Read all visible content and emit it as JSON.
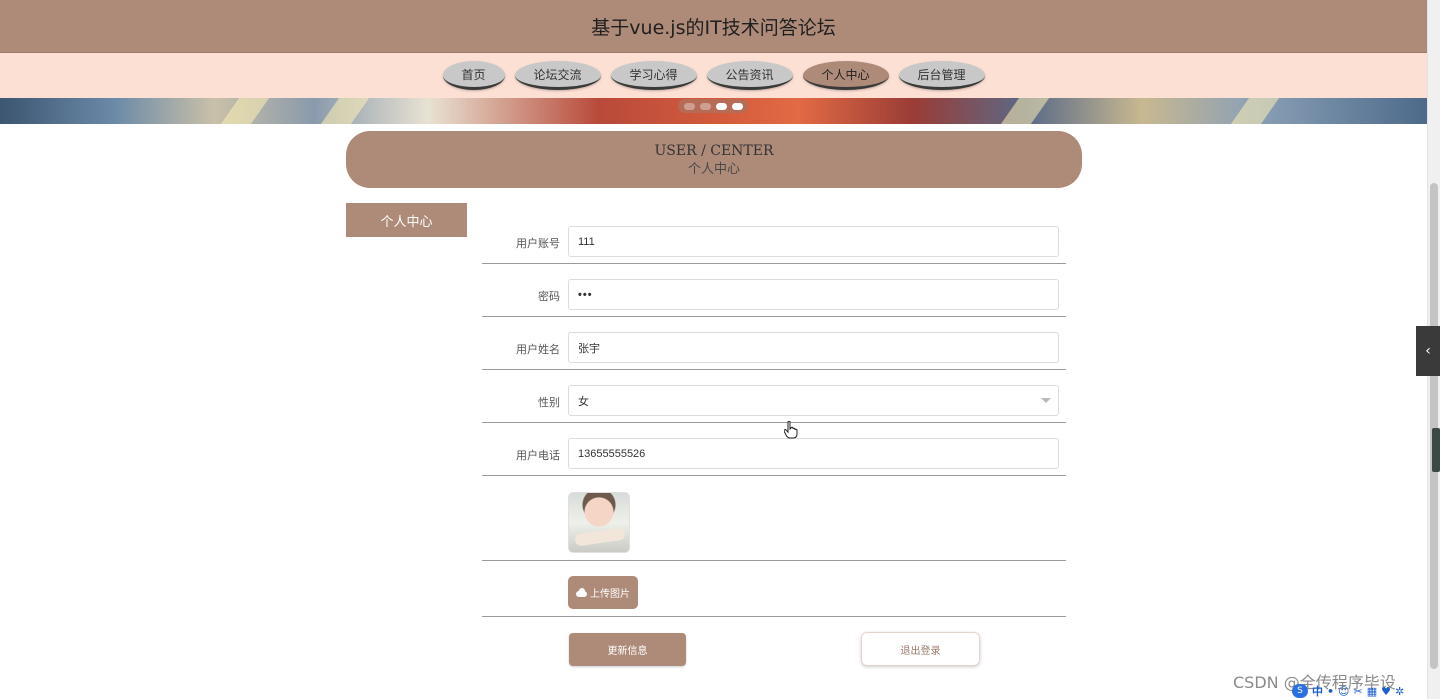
{
  "header": {
    "title": "基于vue.js的IT技术问答论坛"
  },
  "nav": {
    "items": [
      {
        "label": "首页"
      },
      {
        "label": "论坛交流"
      },
      {
        "label": "学习心得"
      },
      {
        "label": "公告资讯"
      },
      {
        "label": "个人中心",
        "active": true
      },
      {
        "label": "后台管理"
      }
    ]
  },
  "section": {
    "title_en": "USER / CENTER",
    "title_zh": "个人中心"
  },
  "sidebar": {
    "tab_label": "个人中心"
  },
  "form": {
    "username": {
      "label": "用户账号",
      "value": "111"
    },
    "password": {
      "label": "密码",
      "value": "•••"
    },
    "name": {
      "label": "用户姓名",
      "value": "张宇"
    },
    "gender": {
      "label": "性别",
      "value": "女"
    },
    "phone": {
      "label": "用户电话",
      "value": "13655555526"
    },
    "upload_label": "上传图片",
    "update_label": "更新信息",
    "logout_label": "退出登录"
  },
  "watermark": "CSDN @全传程序毕设",
  "ime": {
    "mode": "中"
  },
  "colors": {
    "accent": "#ae8a79",
    "nav_bg": "#fde0d4",
    "scrollbar_thumb": "#c4c4c4"
  },
  "icons": [
    "chevron-left-icon",
    "upload-cloud-icon",
    "chevron-down-icon",
    "hand-cursor-icon"
  ]
}
